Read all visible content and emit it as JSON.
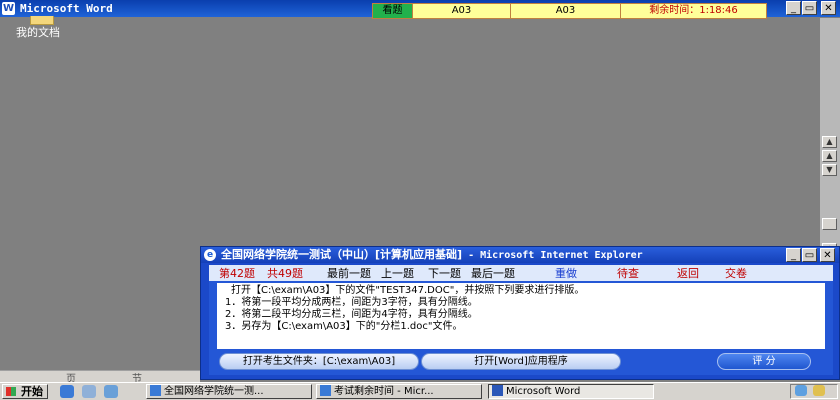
{
  "word": {
    "title": "Microsoft Word",
    "icon_letter": "W"
  },
  "exam_bar": {
    "watch_tab": "看题",
    "code1": "A03",
    "code2": "A03",
    "timer": "剩余时间：1:18:46"
  },
  "desktop": {
    "doc_label": "我的文档"
  },
  "window_controls": {
    "minimize": "_",
    "restore": "▭",
    "close": "✕"
  },
  "page_strip": {
    "page": "页",
    "section": "节"
  },
  "ie": {
    "title_cn": "全国网络学院统一测试（中山）[计算机应用基础]",
    "title_rest": " - Microsoft Internet Explorer",
    "nav": {
      "current": "第42题",
      "total": "共49题",
      "first": "最前一题",
      "prev": "上一题",
      "next": "下一题",
      "last": "最后一题",
      "redo": "重做",
      "pending": "待查",
      "back": "返回",
      "submit": "交卷"
    },
    "question": {
      "intro": "打开【C:\\exam\\A03】下的文件\"TEST347.DOC\"，并按照下列要求进行排版。",
      "steps": [
        "1．将第一段平均分成两栏，间距为3字符，具有分隔线。",
        "2．将第二段平均分成三栏，间距为4字符，具有分隔线。",
        "3．另存为【C:\\exam\\A03】下的\"分栏1.doc\"文件。"
      ]
    },
    "buttons": {
      "open_folder": "打开考生文件夹：[C:\\exam\\A03]",
      "open_app": "打开[Word]应用程序",
      "score": "评 分"
    }
  },
  "taskbar": {
    "start": "开始",
    "tasks": [
      "全国网络学院统一测...",
      "考试剩余时间 - Micr...",
      "Microsoft Word"
    ]
  },
  "colors": {
    "word_title_bar": "#1f4fb8",
    "watch_tab_green": "#22b14c",
    "timer_red": "#c00000",
    "ie_blue": "#1b49c9"
  }
}
